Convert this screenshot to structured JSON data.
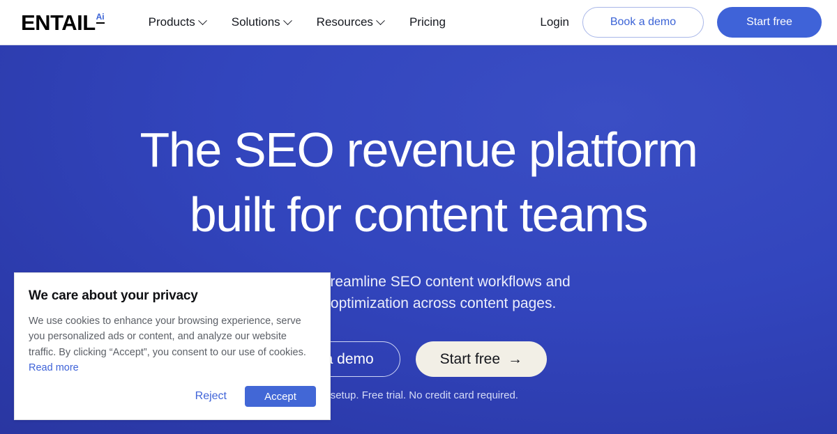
{
  "header": {
    "logo": {
      "word": "ENTAIL",
      "badge": "Ai"
    },
    "nav": [
      {
        "label": "Products",
        "has_chevron": true
      },
      {
        "label": "Solutions",
        "has_chevron": true
      },
      {
        "label": "Resources",
        "has_chevron": true
      },
      {
        "label": "Pricing",
        "has_chevron": false
      }
    ],
    "login_label": "Login",
    "book_demo_label": "Book a demo",
    "start_free_label": "Start free"
  },
  "hero": {
    "title_line1": "The SEO revenue platform",
    "title_line2": "built for content teams",
    "subtitle_line1": "ution to streamline SEO content workflows and",
    "subtitle_line2": "on rate optimization across content pages.",
    "cta_outline_label": "t a demo",
    "cta_cream_label": "Start free",
    "cta_cream_arrow": "→",
    "fineprint": "nt setup. Free trial. No credit card required."
  },
  "cookie_banner": {
    "title": "We care about your privacy",
    "body": "We use cookies to enhance your browsing experience, serve you personalized ads or content, and analyze our website traffic. By clicking “Accept”, you consent to our use of cookies.",
    "read_more_label": "Read more",
    "reject_label": "Reject",
    "accept_label": "Accept"
  },
  "colors": {
    "hero_blue": "#3245bd",
    "hero_blue_dark": "#28339a",
    "accent_blue": "#3f63d8",
    "accept_blue": "#4267d6",
    "cream": "#f2efe6"
  }
}
